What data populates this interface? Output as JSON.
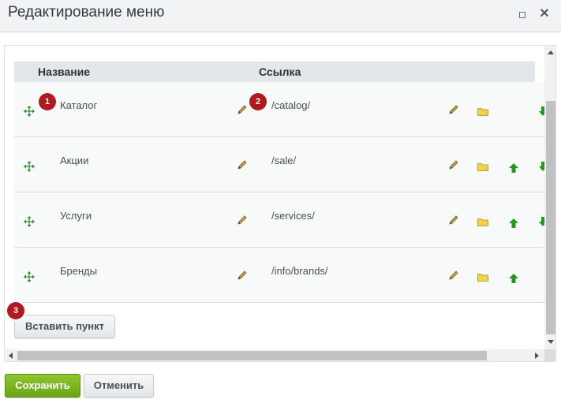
{
  "dialog": {
    "title": "Редактирование меню"
  },
  "table": {
    "headers": {
      "name": "Название",
      "link": "Ссылка"
    },
    "rows": [
      {
        "name": "Каталог",
        "link": "/catalog/",
        "has_up": false,
        "has_down": true
      },
      {
        "name": "Акции",
        "link": "/sale/",
        "has_up": true,
        "has_down": true
      },
      {
        "name": "Услуги",
        "link": "/services/",
        "has_up": true,
        "has_down": true
      },
      {
        "name": "Бренды",
        "link": "/info/brands/",
        "has_up": true,
        "has_down": false
      }
    ]
  },
  "badges": [
    "1",
    "2",
    "3"
  ],
  "buttons": {
    "insert": "Вставить пункт",
    "save": "Сохранить",
    "cancel": "Отменить"
  },
  "icons": {
    "move": "move-arrows-icon",
    "edit": "pencil-icon",
    "folder": "folder-icon",
    "up": "arrow-up-icon",
    "down": "arrow-down-icon"
  },
  "colors": {
    "badge": "#b0191e",
    "save": "#7ab51f",
    "move": "#2e8b2e",
    "arrow": "#1f9a1f",
    "folder": "#f2d24a"
  }
}
